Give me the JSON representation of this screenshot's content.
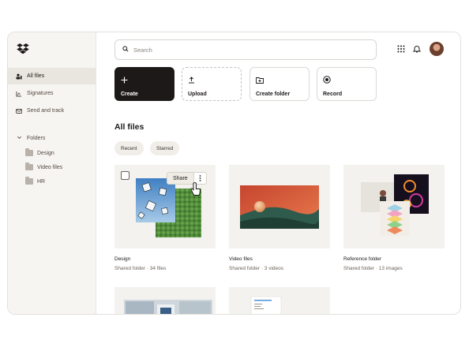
{
  "sidebar": {
    "items": [
      {
        "label": "All files",
        "icon": "people-icon",
        "active": true
      },
      {
        "label": "Signatures",
        "icon": "signature-icon",
        "active": false
      },
      {
        "label": "Send and track",
        "icon": "send-icon",
        "active": false
      }
    ],
    "folders_label": "Folders",
    "folders": [
      "Design",
      "Video files",
      "HR"
    ]
  },
  "search": {
    "placeholder": "Search"
  },
  "actions": [
    {
      "label": "Create",
      "icon": "plus-icon"
    },
    {
      "label": "Upload",
      "icon": "upload-icon"
    },
    {
      "label": "Create folder",
      "icon": "folder-plus-icon"
    },
    {
      "label": "Record",
      "icon": "record-icon"
    }
  ],
  "main": {
    "title": "All files",
    "chips": [
      "Recent",
      "Starred"
    ]
  },
  "cards": [
    {
      "name": "Design",
      "meta": "Shared folder · 34 files",
      "share_label": "Share"
    },
    {
      "name": "Video files",
      "meta": "Shared folder · 3 videos"
    },
    {
      "name": "Reference folder",
      "meta": "Shared folder · 13 images"
    }
  ],
  "colors": {
    "accent_dark": "#1e1919",
    "sidebar_bg": "#f7f5f2",
    "card_bg": "#f4f2ee"
  }
}
